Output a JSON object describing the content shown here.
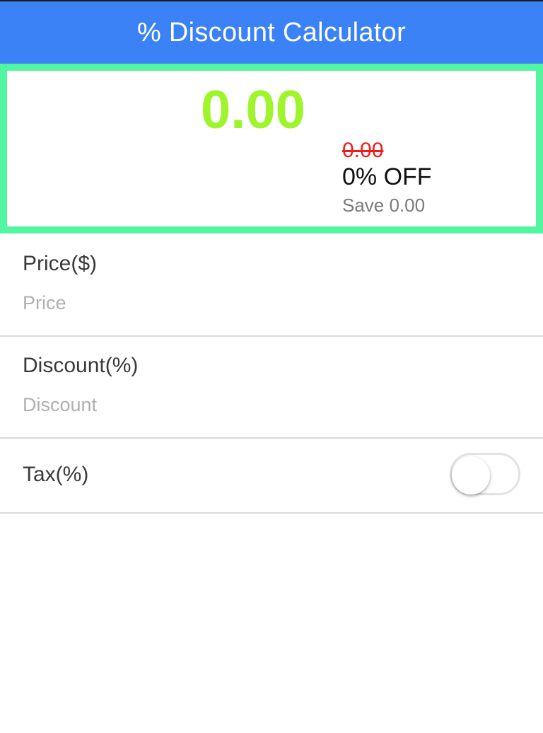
{
  "header": {
    "title": "% Discount Calculator"
  },
  "result": {
    "final_price": "0.00",
    "original_price": "0.00",
    "discount_text": "0% OFF",
    "save_text": "Save 0.00"
  },
  "fields": {
    "price": {
      "label": "Price($)",
      "placeholder": "Price",
      "value": ""
    },
    "discount": {
      "label": "Discount(%)",
      "placeholder": "Discount",
      "value": ""
    },
    "tax": {
      "label": "Tax(%)",
      "enabled": false
    }
  },
  "colors": {
    "header_bg": "#3b82f6",
    "result_border": "#52f5a0",
    "final_price": "#9ef52c",
    "original_price": "#ef1c1c",
    "save_text": "#7a7a7a"
  }
}
